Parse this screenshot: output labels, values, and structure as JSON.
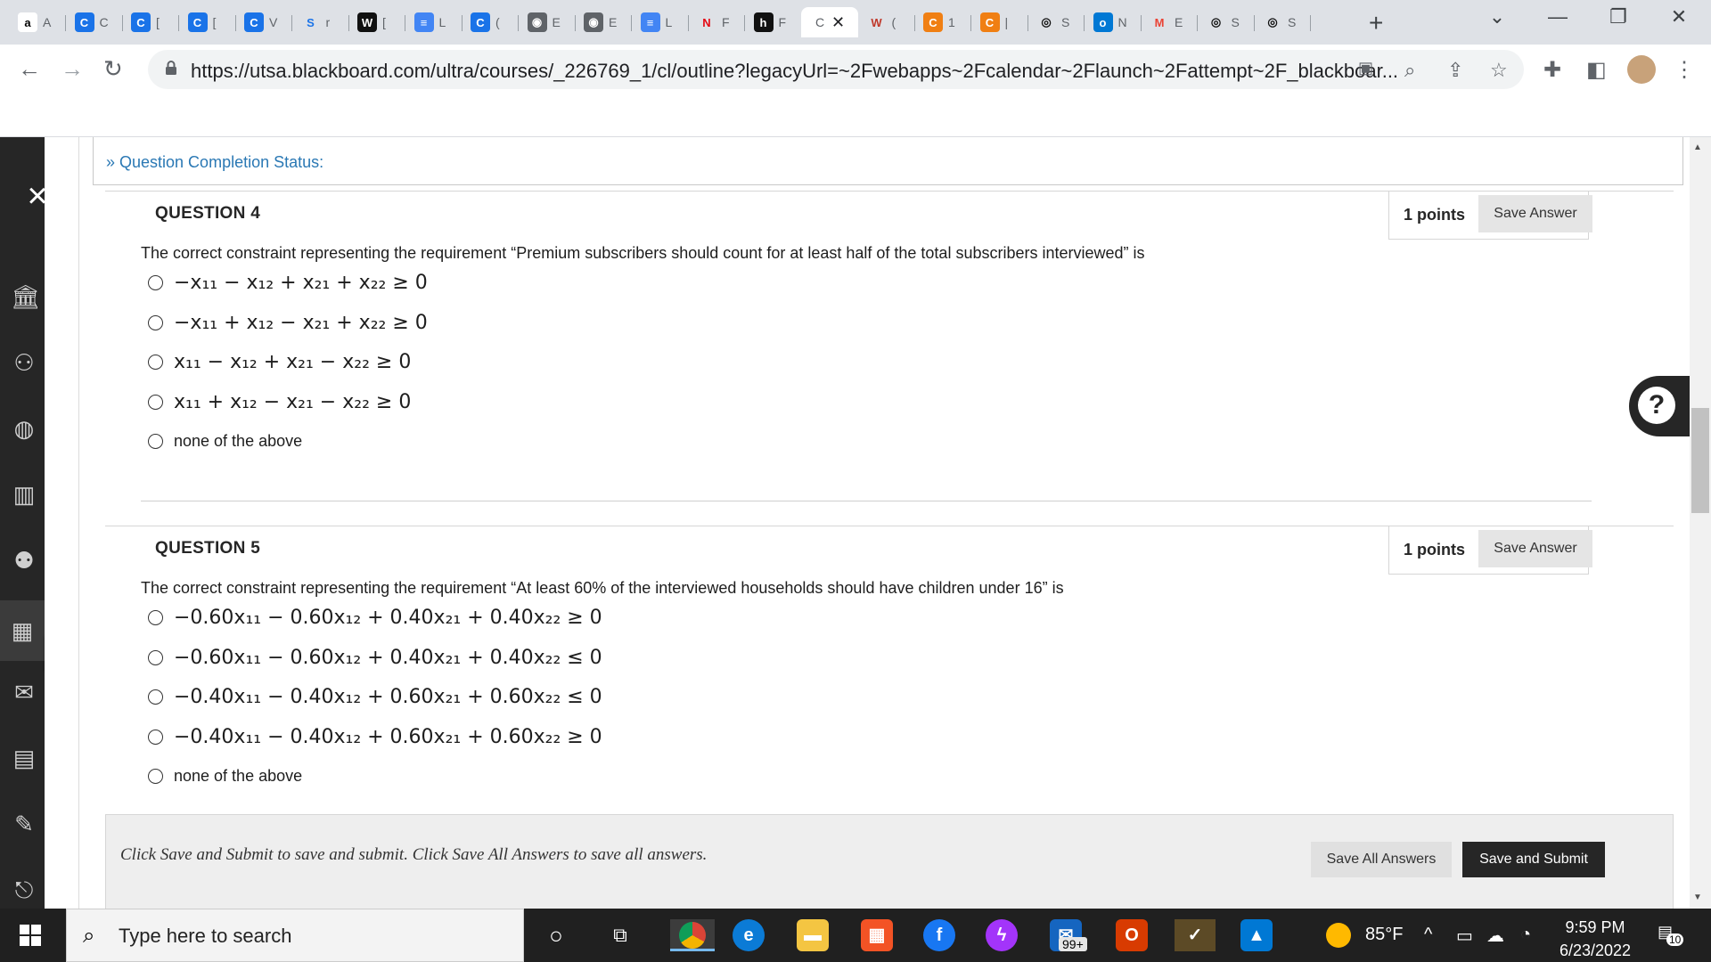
{
  "browser": {
    "tabs": [
      {
        "letter": "a",
        "title": "A",
        "color": "#ffffff",
        "fg": "#000000"
      },
      {
        "letter": "C",
        "title": "C",
        "color": "#1a73e8",
        "fg": "#ffffff"
      },
      {
        "letter": "C",
        "title": "[",
        "color": "#1a73e8",
        "fg": "#ffffff"
      },
      {
        "letter": "C",
        "title": "[",
        "color": "#1a73e8",
        "fg": "#ffffff"
      },
      {
        "letter": "C",
        "title": "V",
        "color": "#1a73e8",
        "fg": "#ffffff"
      },
      {
        "letter": "S",
        "title": "r",
        "color": "#dee1e6",
        "fg": "#1a73e8"
      },
      {
        "letter": "W",
        "title": "[",
        "color": "#111111",
        "fg": "#ffffff"
      },
      {
        "letter": "≡",
        "title": "L",
        "color": "#4285f4",
        "fg": "#ffffff"
      },
      {
        "letter": "C",
        "title": "(",
        "color": "#1a73e8",
        "fg": "#ffffff"
      },
      {
        "letter": "◉",
        "title": "E",
        "color": "#5f6368",
        "fg": "#ffffff"
      },
      {
        "letter": "◉",
        "title": "E",
        "color": "#5f6368",
        "fg": "#ffffff"
      },
      {
        "letter": "≡",
        "title": "L",
        "color": "#4285f4",
        "fg": "#ffffff"
      },
      {
        "letter": "N",
        "title": "F",
        "color": "#dee1e6",
        "fg": "#e50914"
      },
      {
        "letter": "h",
        "title": "F",
        "color": "#111111",
        "fg": "#ffffff"
      },
      {
        "letter": "",
        "title": "C",
        "color": "#ffffff",
        "fg": "#000000",
        "active": true
      },
      {
        "letter": "W",
        "title": "(",
        "color": "#dee1e6",
        "fg": "#c0392b"
      },
      {
        "letter": "C",
        "title": "1",
        "color": "#f07f13",
        "fg": "#ffffff"
      },
      {
        "letter": "C",
        "title": "|",
        "color": "#f07f13",
        "fg": "#ffffff"
      },
      {
        "letter": "◎",
        "title": "S",
        "color": "#dee1e6",
        "fg": "#111111"
      },
      {
        "letter": "o",
        "title": "N",
        "color": "#0078d4",
        "fg": "#ffffff"
      },
      {
        "letter": "M",
        "title": "E",
        "color": "#dee1e6",
        "fg": "#ea4335"
      },
      {
        "letter": "◎",
        "title": "S",
        "color": "#dee1e6",
        "fg": "#111111"
      },
      {
        "letter": "◎",
        "title": "S",
        "color": "#dee1e6",
        "fg": "#111111"
      }
    ],
    "new_tab": "+",
    "url": "https://utsa.blackboard.com/ultra/courses/_226769_1/cl/outline?legacyUrl=~2Fwebapps~2Fcalendar~2Flaunch~2Fattempt~2F_blackboar..."
  },
  "page": {
    "completion_status": "Question Completion Status:",
    "questions": [
      {
        "title": "QUESTION 4",
        "points": "1 points",
        "save_label": "Save Answer",
        "text": "The correct constraint representing the requirement “Premium subscribers should count for at least half of the total subscribers interviewed” is",
        "options": [
          "−x₁₁ − x₁₂ + x₂₁ + x₂₂ ≥ 0",
          "−x₁₁ + x₁₂ − x₂₁ + x₂₂ ≥ 0",
          "x₁₁ − x₁₂ + x₂₁ − x₂₂ ≥ 0",
          "x₁₁ + x₁₂ − x₂₁ − x₂₂ ≥ 0",
          "none of the above"
        ]
      },
      {
        "title": "QUESTION 5",
        "points": "1 points",
        "save_label": "Save Answer",
        "text": "The correct constraint representing the requirement “At least 60% of the interviewed households should have children under 16” is",
        "options": [
          "−0.60x₁₁ − 0.60x₁₂ + 0.40x₂₁ + 0.40x₂₂ ≥ 0",
          "−0.60x₁₁ − 0.60x₁₂ + 0.40x₂₁ + 0.40x₂₂ ≤ 0",
          "−0.40x₁₁ − 0.40x₁₂ + 0.60x₂₁ + 0.60x₂₂ ≤ 0",
          "−0.40x₁₁ − 0.40x₁₂ + 0.60x₂₁ + 0.60x₂₂ ≥ 0",
          "none of the above"
        ]
      }
    ],
    "footer": {
      "message": "Click Save and Submit to save and submit. Click Save All Answers to save all answers.",
      "save_all": "Save All Answers",
      "save_submit": "Save and Submit"
    },
    "help": "?"
  },
  "taskbar": {
    "search_placeholder": "Type here to search",
    "mail_badge": "99+",
    "temperature": "85°F",
    "time": "9:59 PM",
    "date": "6/23/2022",
    "notification_count": "10"
  }
}
